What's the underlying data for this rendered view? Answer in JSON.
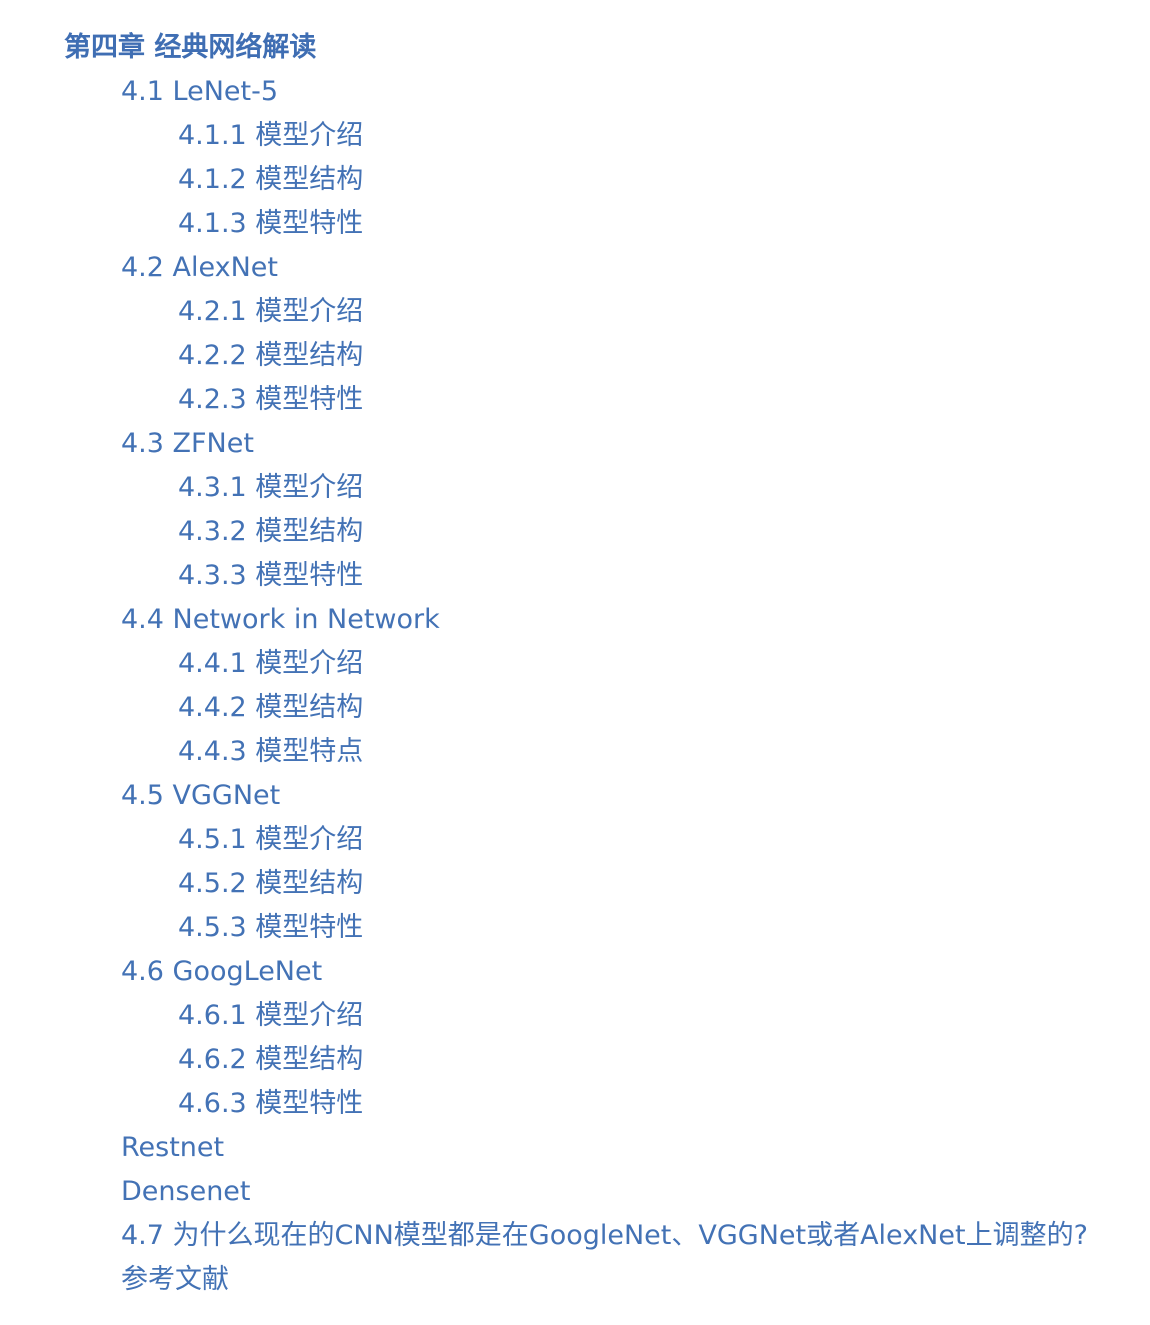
{
  "toc": {
    "chapter_title": "第四章 经典网络解读",
    "items": [
      {
        "label": "4.1 LeNet-5"
      },
      {
        "label": "4.1.1 模型介绍"
      },
      {
        "label": "4.1.2 模型结构"
      },
      {
        "label": "4.1.3 模型特性"
      },
      {
        "label": "4.2 AlexNet"
      },
      {
        "label": "4.2.1 模型介绍"
      },
      {
        "label": "4.2.2 模型结构"
      },
      {
        "label": "4.2.3 模型特性"
      },
      {
        "label": "4.3 ZFNet"
      },
      {
        "label": "4.3.1 模型介绍"
      },
      {
        "label": "4.3.2 模型结构"
      },
      {
        "label": "4.3.3 模型特性"
      },
      {
        "label": "4.4 Network in Network"
      },
      {
        "label": "4.4.1 模型介绍"
      },
      {
        "label": "4.4.2 模型结构"
      },
      {
        "label": "4.4.3 模型特点"
      },
      {
        "label": "4.5 VGGNet"
      },
      {
        "label": "4.5.1 模型介绍"
      },
      {
        "label": "4.5.2 模型结构"
      },
      {
        "label": "4.5.3 模型特性"
      },
      {
        "label": "4.6 GoogLeNet"
      },
      {
        "label": "4.6.1 模型介绍"
      },
      {
        "label": "4.6.2 模型结构"
      },
      {
        "label": "4.6.3 模型特性"
      },
      {
        "label": "Restnet"
      },
      {
        "label": "Densenet"
      },
      {
        "label": "4.7 为什么现在的CNN模型都是在GoogleNet、VGGNet或者AlexNet上调整的?"
      },
      {
        "label": "参考文献"
      }
    ]
  },
  "colors": {
    "link": "#4372b5",
    "background": "#ffffff"
  }
}
